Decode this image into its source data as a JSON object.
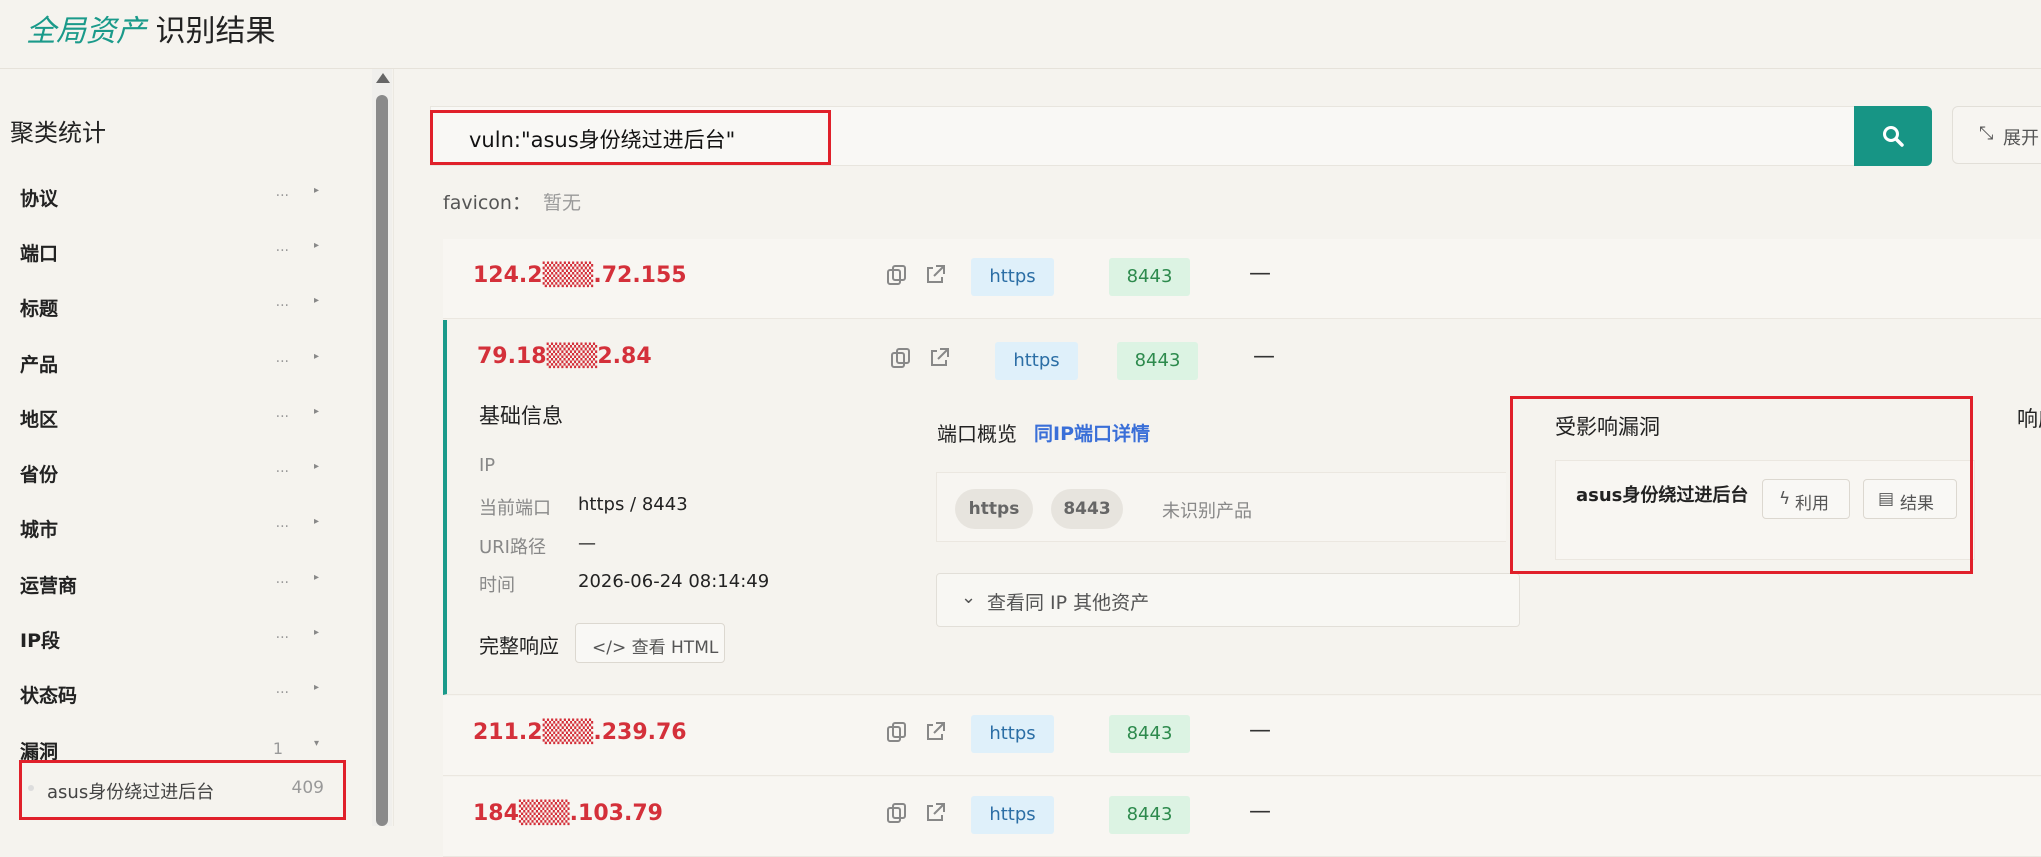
{
  "header": {
    "title_accent": "全局资产",
    "title_rest": "识别结果"
  },
  "sidebar": {
    "title": "聚类统计",
    "categories": [
      {
        "label": "协议",
        "extra": "...",
        "arrow": "▸"
      },
      {
        "label": "端口",
        "extra": "...",
        "arrow": "▸"
      },
      {
        "label": "标题",
        "extra": "...",
        "arrow": "▸"
      },
      {
        "label": "产品",
        "extra": "...",
        "arrow": "▸"
      },
      {
        "label": "地区",
        "extra": "...",
        "arrow": "▸"
      },
      {
        "label": "省份",
        "extra": "...",
        "arrow": "▸"
      },
      {
        "label": "城市",
        "extra": "...",
        "arrow": "▸"
      },
      {
        "label": "运营商",
        "extra": "...",
        "arrow": "▸"
      },
      {
        "label": "IP段",
        "extra": "...",
        "arrow": "▸"
      },
      {
        "label": "状态码",
        "extra": "...",
        "arrow": "▸"
      },
      {
        "label": "漏洞",
        "count": "1",
        "arrow": "▾"
      }
    ],
    "vuln_sub": {
      "label": "asus身份绕过进后台",
      "count": "409"
    }
  },
  "search": {
    "value": "vuln:\"asus身份绕过进后台\"",
    "expand_label": "展开"
  },
  "favicon": {
    "label": "favicon：",
    "value": "暂无"
  },
  "results": [
    {
      "ip": "124.2▒▒▒.72.155",
      "protocol": "https",
      "port": "8443",
      "status": "—"
    },
    {
      "ip": "79.18▒▒▒2.84",
      "protocol": "https",
      "port": "8443",
      "status": "—"
    },
    {
      "ip": "211.2▒▒▒.239.76",
      "protocol": "https",
      "port": "8443",
      "status": "—"
    },
    {
      "ip": "184▒▒▒.103.79",
      "protocol": "https",
      "port": "8443",
      "status": "—"
    }
  ],
  "detail": {
    "basic_title": "基础信息",
    "fields": [
      {
        "key": "IP",
        "value": ""
      },
      {
        "key": "当前端口",
        "value": "https / 8443"
      },
      {
        "key": "URI路径",
        "value": "—"
      },
      {
        "key": "时间",
        "value": "2026-06-24 08:14:49"
      }
    ],
    "full_response": "完整响应",
    "view_html": "</> 查看 HTML",
    "port_overview": "端口概览",
    "same_ip_link": "同IP端口详情",
    "port_pills": [
      "https",
      "8443"
    ],
    "unrecognized": "未识别产品",
    "other_assets": "查看同 IP 其他资产",
    "vuln_title": "受影响漏洞",
    "vuln_name": "asus身份绕过进后台",
    "use_btn": "利用",
    "result_btn": "结果",
    "resp_title": "响应"
  },
  "colors": {
    "accent": "#1a9a8a",
    "ip_red": "#d4303a",
    "link_blue": "#3a6fd8",
    "highlight_box": "#e0202a"
  }
}
